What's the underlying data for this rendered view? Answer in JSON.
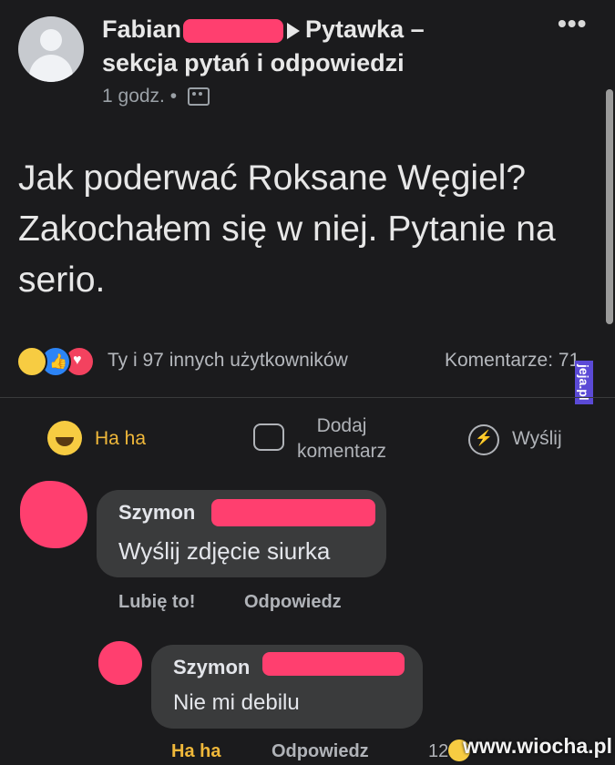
{
  "post": {
    "author": "Fabian",
    "group": "Pytawka –\nsekcja pytań i odpowiedzi",
    "time": "1 godz.",
    "separator": "•",
    "more": "•••",
    "text": "Jak poderwać Roksane Węgiel? Zakochałem się w niej. Pytanie na serio."
  },
  "reactions": {
    "summary": "Ty i 97 innych użytkowników",
    "comments": "Komentarze: 71"
  },
  "actions": {
    "haha": "Ha ha",
    "comment": "Dodaj komentarz",
    "send": "Wyślij"
  },
  "comments": [
    {
      "name": "Szymon",
      "text": "Wyślij zdjęcie siurka",
      "like": "Lubię to!",
      "reply": "Odpowiedz"
    },
    {
      "name": "Szymon",
      "text": "Nie mi debilu",
      "reaction": "Ha ha",
      "reply": "Odpowiedz",
      "count": "12"
    }
  ],
  "watermarks": {
    "side": "jeja.pl",
    "corner": "www.wiocha.pl"
  },
  "colors": {
    "background": "#1b1b1d",
    "redaction": "#ff3f6f",
    "haha": "#f0b83a"
  }
}
